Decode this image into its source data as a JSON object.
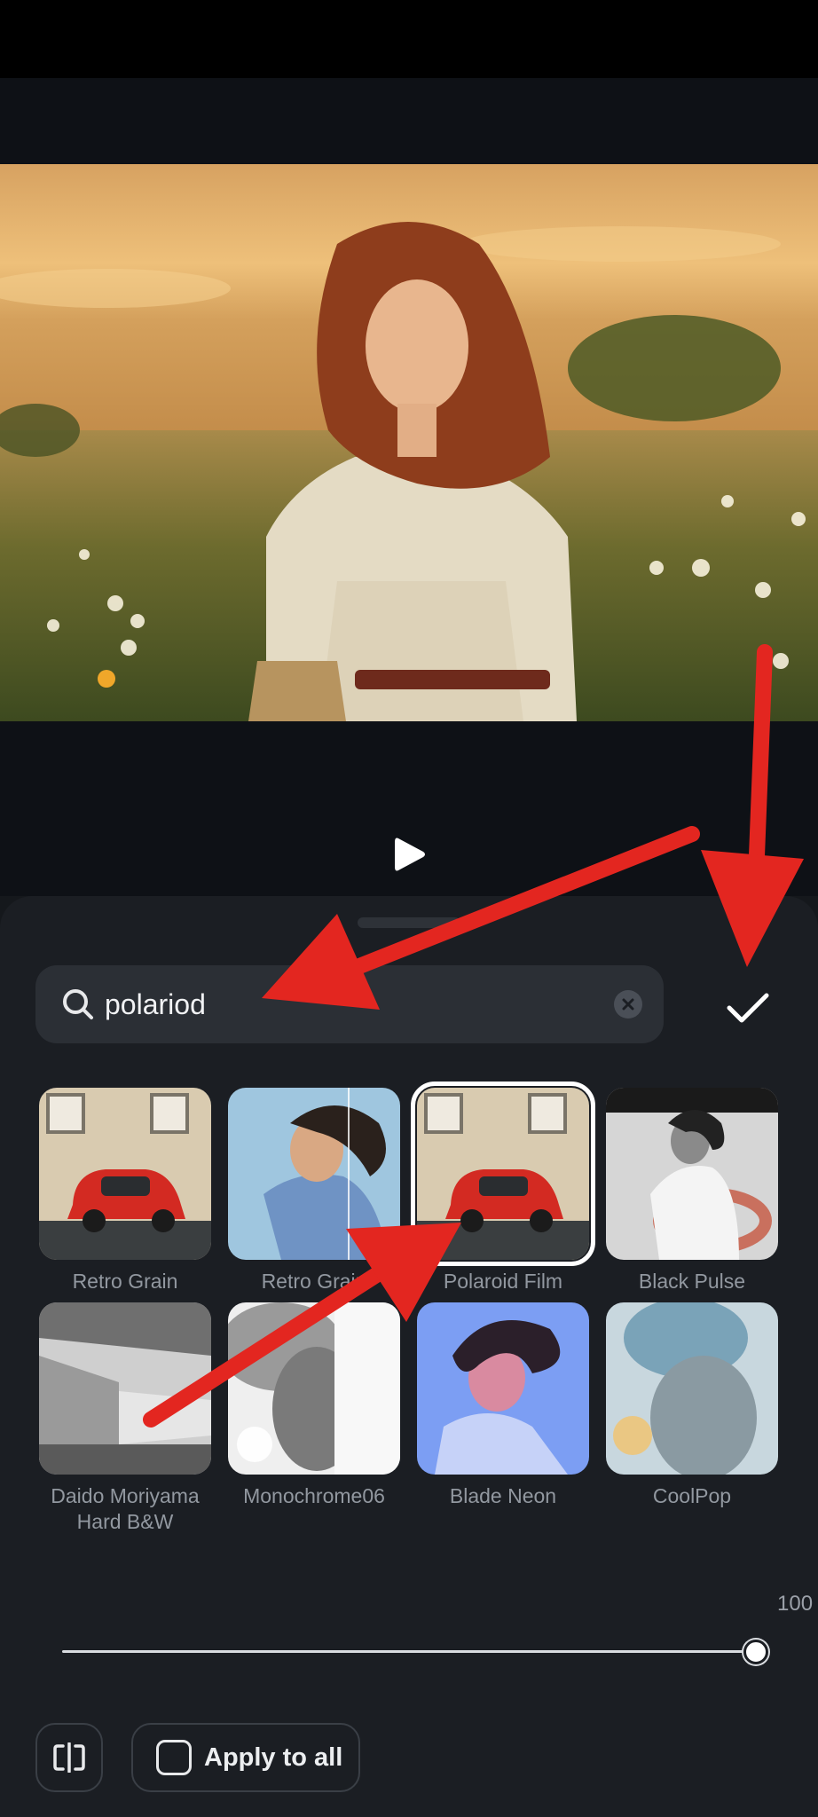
{
  "editor": {
    "search": {
      "value": "polariod"
    },
    "filters": [
      {
        "label": "Retro Grain",
        "thumb": "red-car",
        "selected": false
      },
      {
        "label": "Retro Grain",
        "thumb": "woman-denim",
        "selected": false
      },
      {
        "label": "Polaroid Film",
        "thumb": "red-car",
        "selected": true
      },
      {
        "label": "Black Pulse",
        "thumb": "woman-bw",
        "selected": false
      },
      {
        "label": "Daido Moriyama\nHard B&W",
        "thumb": "building-bw",
        "selected": false
      },
      {
        "label": "Monochrome06",
        "thumb": "portrait-bw",
        "selected": false
      },
      {
        "label": "Blade Neon",
        "thumb": "woman-neon",
        "selected": false
      },
      {
        "label": "CoolPop",
        "thumb": "portrait-cool",
        "selected": false
      }
    ],
    "intensity": {
      "value": "100",
      "fraction": 1.0
    },
    "apply_all": {
      "label": "Apply to all",
      "checked": false
    },
    "icons": {
      "play": "play-icon",
      "search": "search-icon",
      "clear": "close-icon",
      "confirm": "checkmark-icon",
      "compare": "compare-icon"
    },
    "colors": {
      "accent_annotation": "#e32620",
      "selected_outline": "#ffffff"
    }
  }
}
